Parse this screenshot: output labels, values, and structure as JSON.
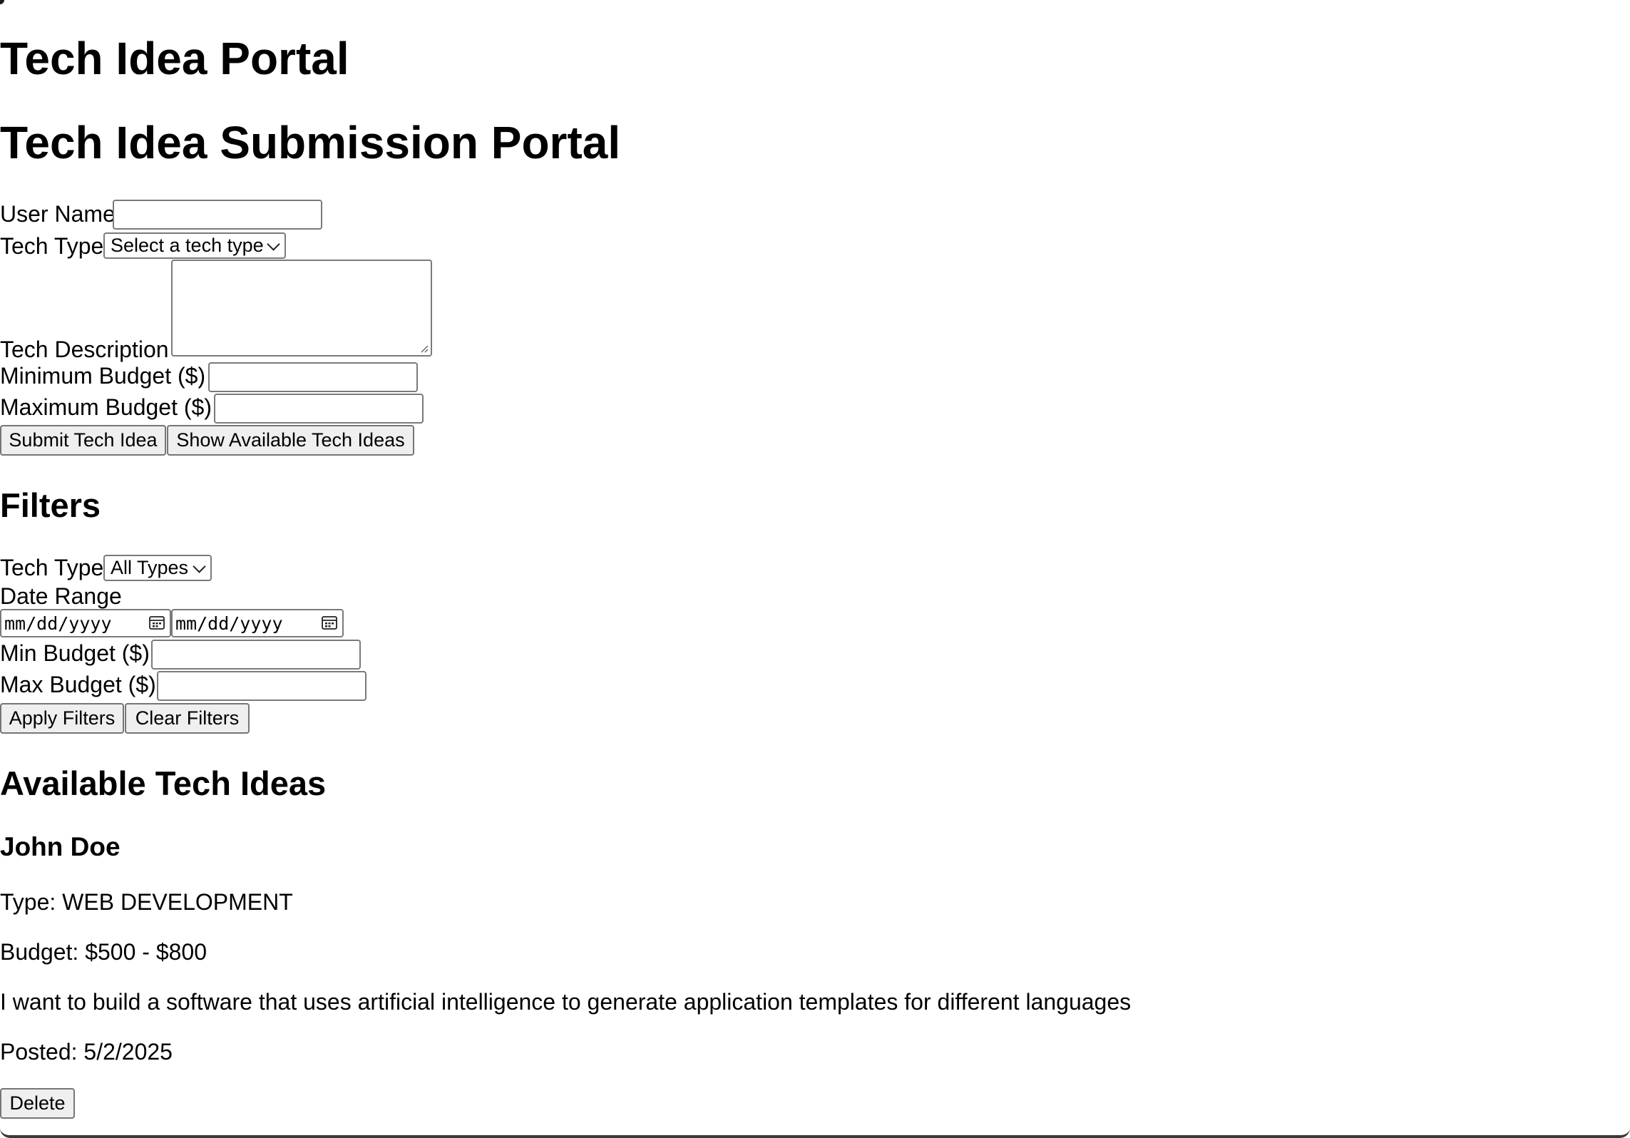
{
  "page": {
    "title": "Tech Idea Portal",
    "subtitle": "Tech Idea Submission Portal"
  },
  "submission_form": {
    "user_name_label": "User Name",
    "user_name_value": "",
    "tech_type_label": "Tech Type",
    "tech_type_selected": "Select a tech type",
    "tech_description_label": "Tech Description",
    "tech_description_value": "",
    "min_budget_label": "Minimum Budget ($)",
    "min_budget_value": "",
    "max_budget_label": "Maximum Budget ($)",
    "max_budget_value": "",
    "submit_label": "Submit Tech Idea",
    "show_available_label": "Show Available Tech Ideas"
  },
  "filters": {
    "heading": "Filters",
    "tech_type_label": "Tech Type",
    "tech_type_selected": "All Types",
    "date_range_label": "Date Range",
    "date_start_placeholder": "mm/dd/yyyy",
    "date_end_placeholder": "mm/dd/yyyy",
    "min_budget_label": "Min Budget ($)",
    "min_budget_value": "",
    "max_budget_label": "Max Budget ($)",
    "max_budget_value": "",
    "apply_label": "Apply Filters",
    "clear_label": "Clear Filters"
  },
  "available": {
    "heading": "Available Tech Ideas",
    "ideas": [
      {
        "user": "John Doe",
        "type": "Type: WEB DEVELOPMENT",
        "budget": "Budget: $500 - $800",
        "description": "I want to build a software that uses artificial intelligence to generate application templates for different languages",
        "posted": "Posted: 5/2/2025",
        "delete_label": "Delete"
      }
    ]
  },
  "icons": {
    "date_start_icon": "calendar-icon",
    "date_end_icon": "calendar-icon",
    "select_chevron": "chevron-down-icon",
    "textarea_resize": "resize-handle-icon"
  }
}
